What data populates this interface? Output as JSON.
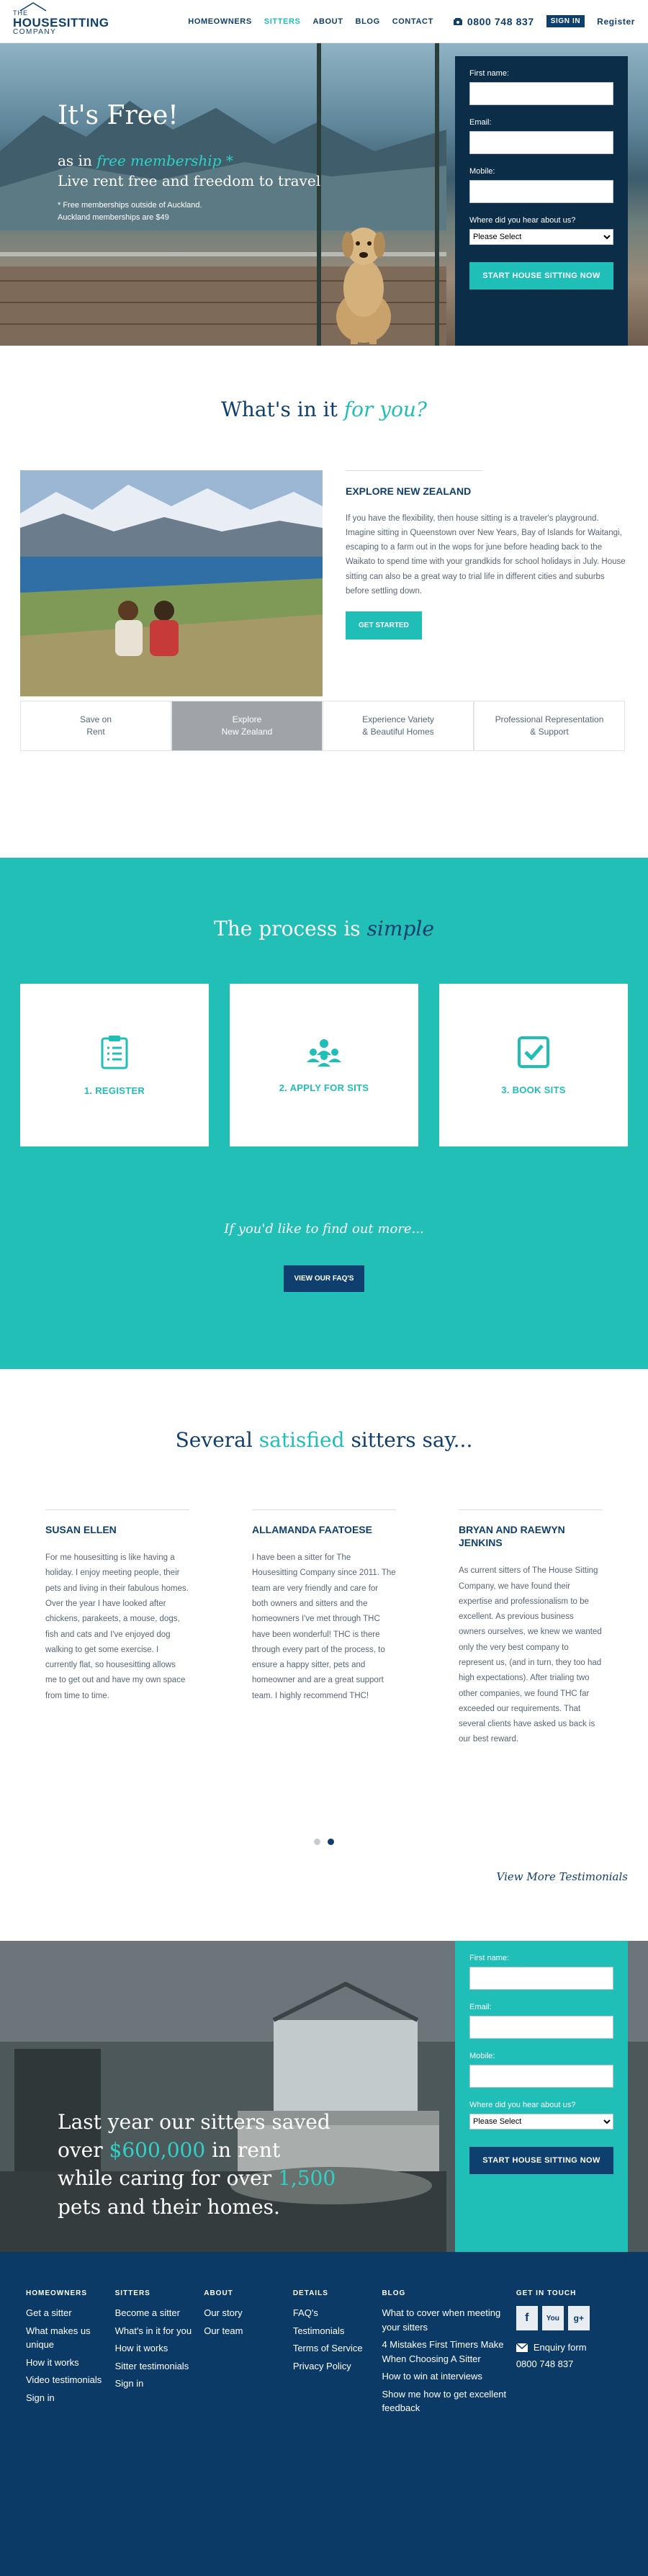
{
  "header": {
    "logo": {
      "the": "THE",
      "main": "HOUSESITTING",
      "company": "COMPANY"
    },
    "nav": [
      {
        "label": "HOMEOWNERS",
        "active": false
      },
      {
        "label": "SITTERS",
        "active": true
      },
      {
        "label": "ABOUT",
        "active": false
      },
      {
        "label": "BLOG",
        "active": false
      },
      {
        "label": "CONTACT",
        "active": false
      }
    ],
    "phone": "0800 748 837",
    "signin": "SIGN IN",
    "register": "Register"
  },
  "hero": {
    "title": "It's Free!",
    "line1_prefix": "as in",
    "line1_highlight": "free membership *",
    "line2": "Live rent free and freedom to travel",
    "note1": "* Free memberships outside of Auckland.",
    "note2": "Auckland memberships are $49"
  },
  "signup_form": {
    "first_name_label": "First name:",
    "email_label": "Email:",
    "mobile_label": "Mobile:",
    "hear_label": "Where did you hear about us?",
    "select_value": "Please Select",
    "submit": "START HOUSE SITTING NOW"
  },
  "whats_in_it": {
    "title_plain": "What's in it",
    "title_em": "for you?",
    "heading": "EXPLORE NEW ZEALAND",
    "body": "If you have the flexibility, then house sitting is a traveler's playground. Imagine sitting in Queenstown over New Years, Bay of Islands for Waitangi, escaping to a farm out in the wops for june before heading back to the Waikato to spend time with your grandkids for school holidays in July. House sitting can also be a great way to trial life in different cities and suburbs before settling down.",
    "button": "GET STARTED",
    "tabs": [
      {
        "l1": "Save on",
        "l2": "Rent"
      },
      {
        "l1": "Explore",
        "l2": "New Zealand"
      },
      {
        "l1": "Experience Variety",
        "l2": "& Beautiful Homes"
      },
      {
        "l1": "Professional Representation",
        "l2": "& Support"
      }
    ]
  },
  "process": {
    "title_plain": "The process is",
    "title_em": "simple",
    "steps": [
      "1. REGISTER",
      "2. APPLY FOR SITS",
      "3. BOOK SITS"
    ],
    "findout": "If you'd like to find out more...",
    "faq_button": "VIEW OUR FAQ'S"
  },
  "testimonials": {
    "title_plain1": "Several",
    "title_em": "satisfied",
    "title_plain2": "sitters say...",
    "items": [
      {
        "name": "SUSAN ELLEN",
        "text": "For me housesitting is like having a holiday. I enjoy meeting people, their pets and living in their fabulous homes. Over the year I have looked after chickens, parakeets, a mouse, dogs, fish and cats and I've enjoyed dog walking to get some exercise. I currently flat, so housesitting allows me to get out and have my own space from time to time."
      },
      {
        "name": "ALLAMANDA FAATOESE",
        "text": "I have been a sitter for The Housesitting Company since 2011. The team are very friendly and care for both owners and sitters and the homeowners I've met through THC have been wonderful! THC is there through every part of the process, to ensure a happy sitter, pets and homeowner and are a great support team. I highly recommend THC!"
      },
      {
        "name": "BRYAN AND RAEWYN JENKINS",
        "text": "As current sitters of The House Sitting Company, we have found their expertise and professionalism to be excellent. As previous business owners ourselves, we knew we wanted only the very best company to represent us, (and in turn, they too had high expectations). After trialing two other companies, we found THC far exceeded our requirements. That several clients have asked us back is our best reward."
      }
    ],
    "view_more": "View More Testimonials"
  },
  "saved": {
    "l1": "Last year our sitters saved",
    "l2_pre": "over",
    "l2_em": "$600,000",
    "l2_post": "in rent",
    "l3_pre": "while caring for over",
    "l3_em": "1,500",
    "l4": "pets and their homes."
  },
  "footer": {
    "homeowners": {
      "title": "HOMEOWNERS",
      "links": [
        "Get a sitter",
        "What makes us unique",
        "How it works",
        "Video testimonials",
        "Sign in"
      ]
    },
    "sitters": {
      "title": "SITTERS",
      "links": [
        "Become a sitter",
        "What's in it for you",
        "How it works",
        "Sitter testimonials",
        "Sign in"
      ]
    },
    "about": {
      "title": "ABOUT",
      "links": [
        "Our story",
        "Our team"
      ]
    },
    "details": {
      "title": "DETAILS",
      "links": [
        "FAQ's",
        "Testimonials",
        "Terms of Service",
        "Privacy Policy"
      ]
    },
    "blog": {
      "title": "BLOG",
      "links": [
        "What to cover when meeting your sitters",
        "4 Mistakes First Timers Make When Choosing A Sitter",
        "How to win at interviews",
        "Show me how to get excellent feedback"
      ]
    },
    "contact": {
      "title": "GET IN TOUCH",
      "enquiry": "Enquiry form",
      "phone": "0800 748 837",
      "social": [
        "f",
        "You",
        "g+"
      ]
    }
  }
}
